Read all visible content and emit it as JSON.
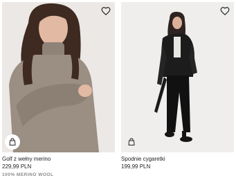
{
  "products": [
    {
      "name": "Golf z wełny merino",
      "price": "229,99 PLN",
      "tag": "100% MERINO WOOL"
    },
    {
      "name": "Spodnie cygaretki",
      "price": "199,99 PLN"
    }
  ],
  "icons": {
    "wishlist": "heart-outline-icon",
    "add_to_bag": "shopping-bag-icon"
  },
  "colors": {
    "photo_background": "#e9e7e5",
    "text": "#222222",
    "tag_text": "#8a8a8a"
  }
}
